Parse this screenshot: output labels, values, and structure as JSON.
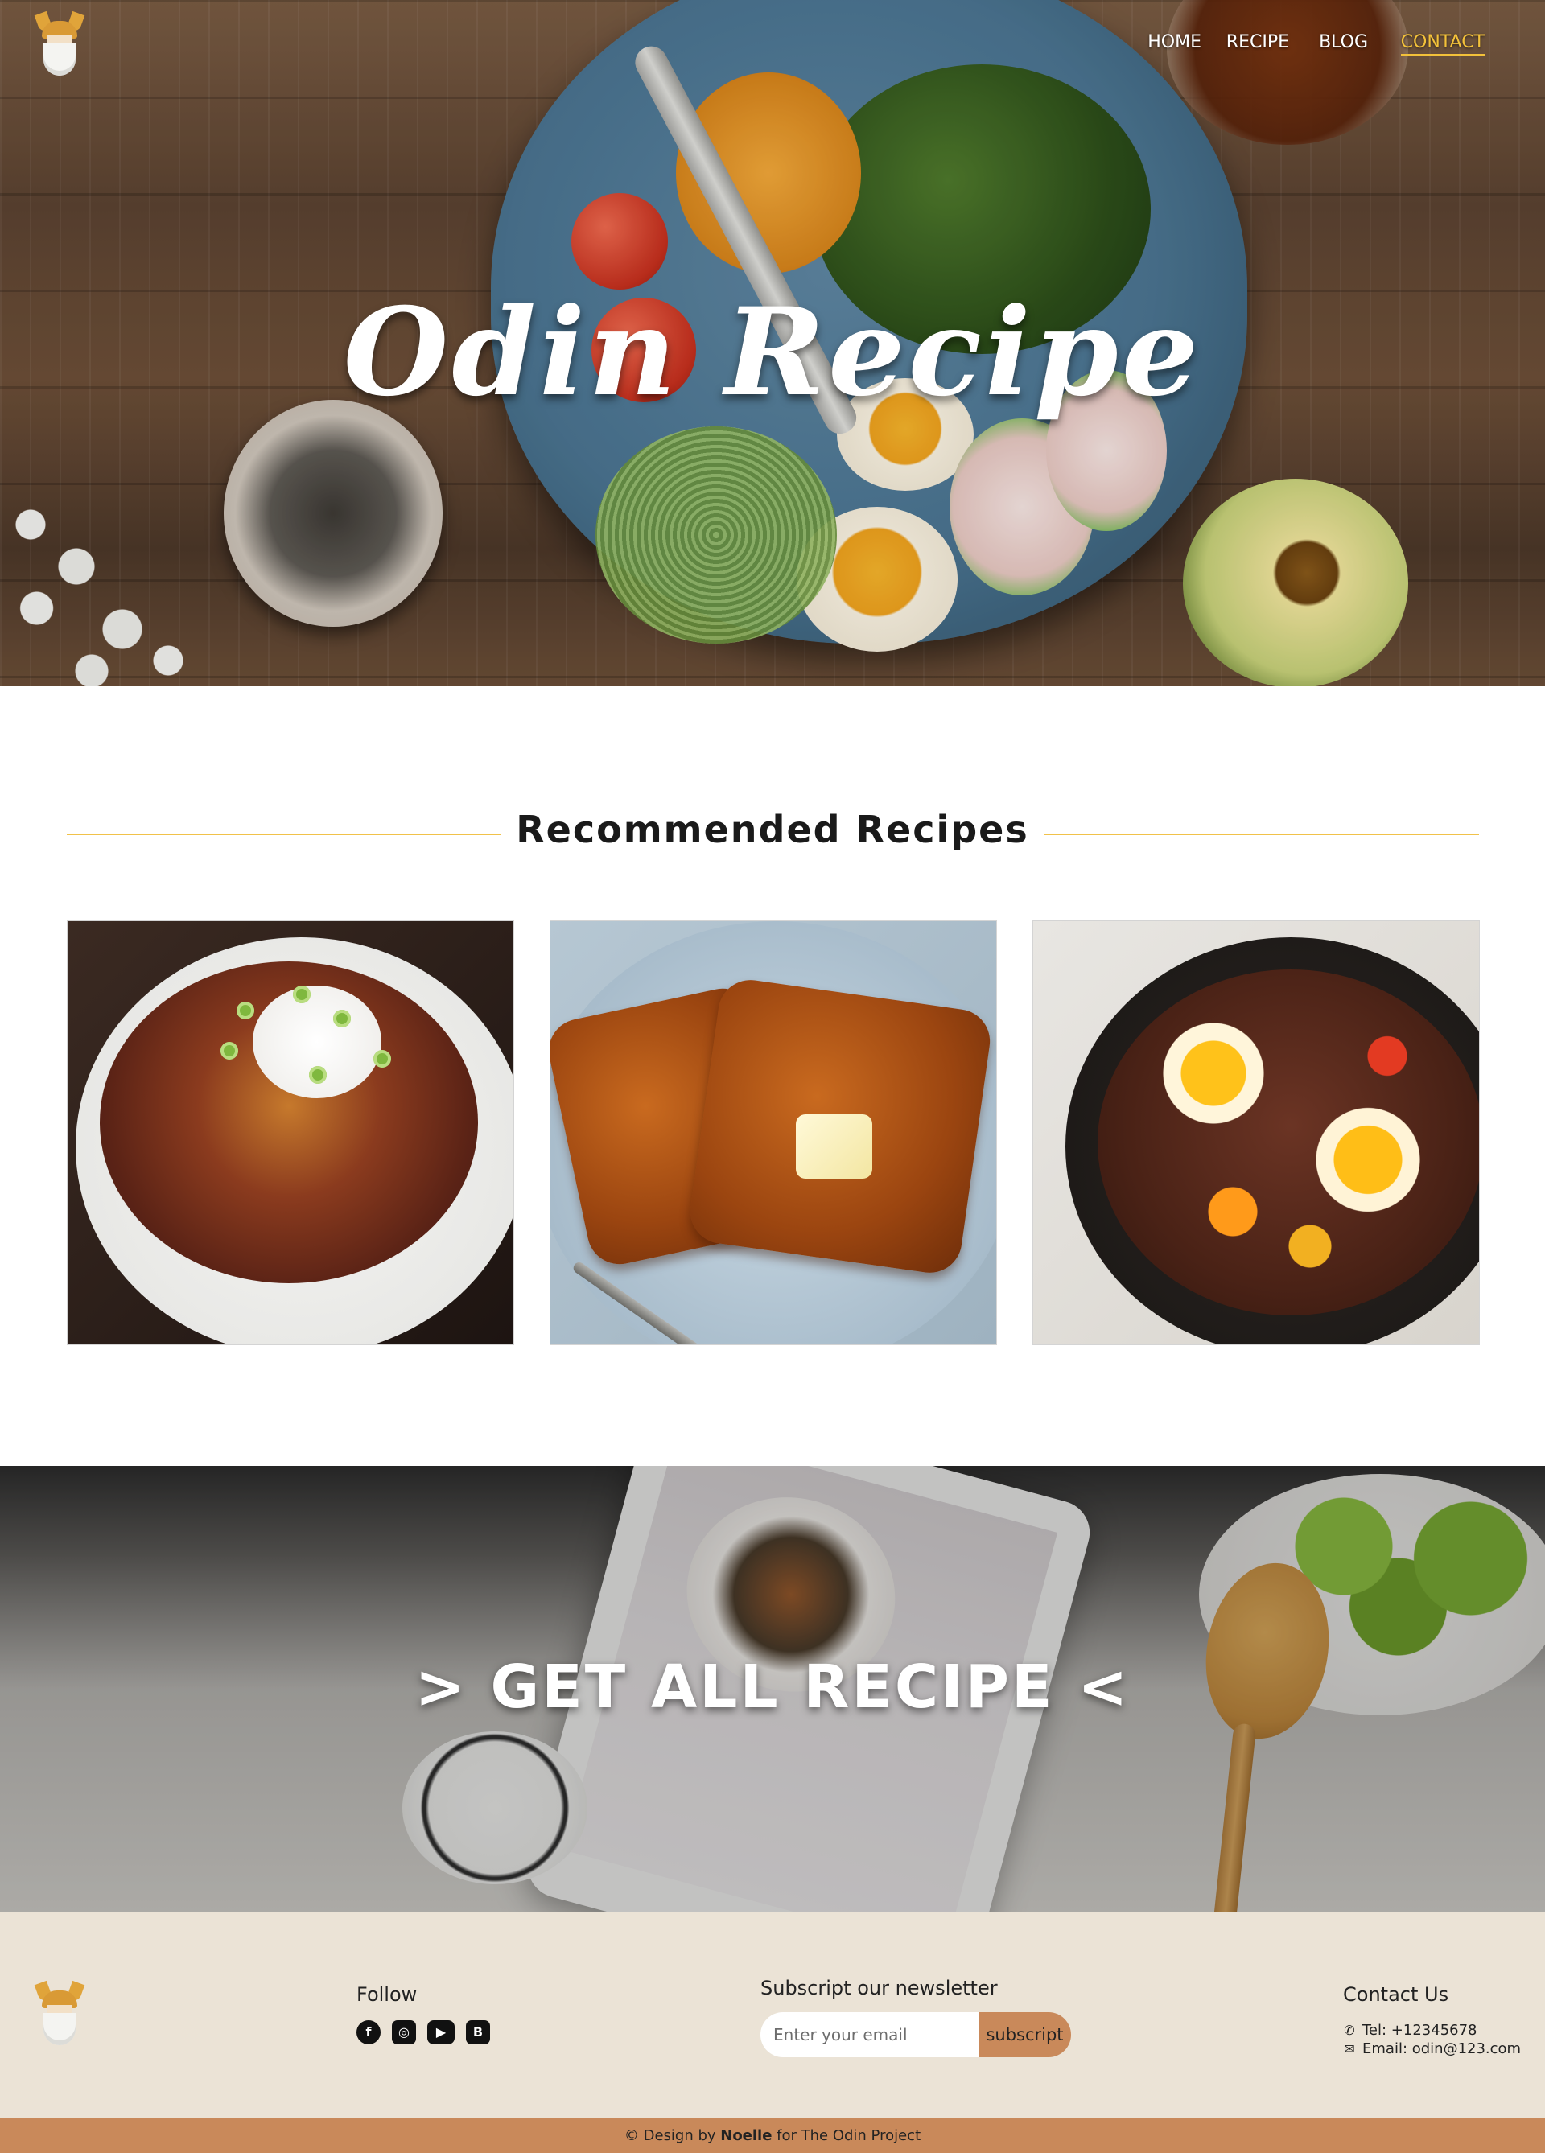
{
  "nav": {
    "items": [
      {
        "label": "HOME",
        "active": false
      },
      {
        "label": "RECIPE",
        "active": false
      },
      {
        "label": "BLOG",
        "active": false
      },
      {
        "label": "CONTACT",
        "active": true
      }
    ]
  },
  "hero": {
    "title": "Odin Recipe"
  },
  "recommended": {
    "heading": "Recommended Recipes",
    "cards": [
      {
        "image": "chili-bowl-photo"
      },
      {
        "image": "french-toast-photo"
      },
      {
        "image": "skillet-eggs-photo"
      }
    ]
  },
  "banner": {
    "text": "> GET ALL RECIPE <"
  },
  "footer": {
    "follow_label": "Follow",
    "social_icons": [
      "facebook-icon",
      "instagram-icon",
      "youtube-icon",
      "blogger-icon"
    ],
    "newsletter_label": "Subscript our newsletter",
    "newsletter_placeholder": "Enter your email",
    "newsletter_button": "subscript",
    "contact_label": "Contact Us",
    "tel": "Tel: +12345678",
    "email": "Email: odin@123.com"
  },
  "copyright": {
    "prefix": "© Design by ",
    "author": "Noelle",
    "suffix": " for The Odin Project"
  },
  "colors": {
    "accent": "#f3c13a",
    "footer_bg": "#ebe3d6",
    "copyright_bg": "#c9895a",
    "button_bg": "#c9895a"
  }
}
